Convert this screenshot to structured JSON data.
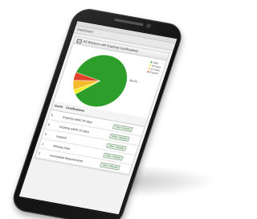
{
  "screen": {
    "page_title": "Dashboard",
    "panel_title": "All Workers with Expiring Certifications"
  },
  "chart_data": {
    "type": "pie",
    "title": "All Workers with Expiring Certifications",
    "slices": [
      {
        "name": "Valid",
        "value": 86.0,
        "color": "#2e9e2b"
      },
      {
        "name": "30 Days",
        "value": 3.0,
        "color": "#f2ef28"
      },
      {
        "name": "15 Days",
        "value": 6.0,
        "color": "#f3bb2c"
      },
      {
        "name": "Expired",
        "value": 5.0,
        "color": "#e4432b"
      }
    ],
    "data_labels": [
      "86.0%"
    ],
    "legend": "top-right"
  },
  "table": {
    "headers": [
      "Count",
      "Certifications",
      ""
    ],
    "rows": [
      {
        "count": "9",
        "label": "Expiring within 30 days",
        "action": "View Details"
      },
      {
        "count": "0",
        "label": "Expiring within 15 days",
        "action": "View Details"
      },
      {
        "count": "0",
        "label": "Expired",
        "action": "View Details"
      },
      {
        "count": "1",
        "label": "Missing Data",
        "action": "View Details"
      },
      {
        "count": "2",
        "label": "Incomplete Requirements",
        "action": "View Details"
      }
    ]
  }
}
